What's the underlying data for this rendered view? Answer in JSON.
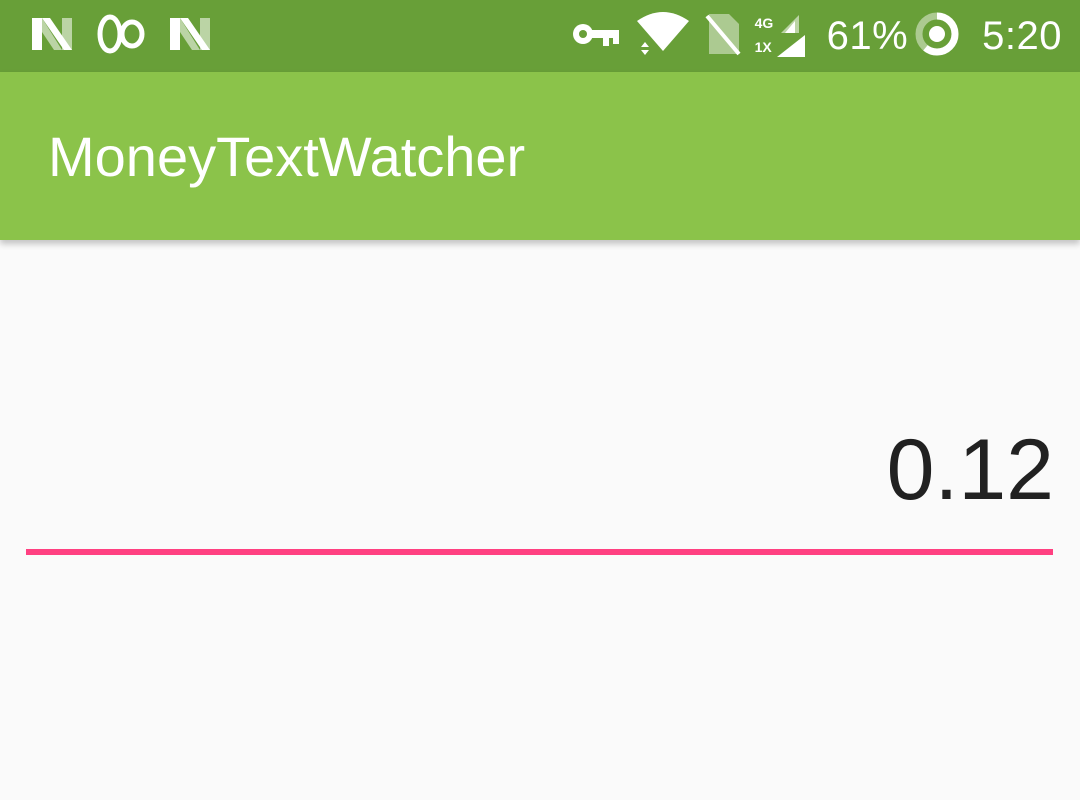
{
  "status_bar": {
    "left_icons": [
      "n-notification-icon",
      "infinity-icon",
      "n-notification-icon"
    ],
    "right_icons": [
      "vpn-key-icon",
      "wifi-icon",
      "no-sim-icon",
      "signal-icon"
    ],
    "network_type": "4G",
    "sim_slot": "1X",
    "battery_percent": "61%",
    "battery_level": 0.61,
    "time": "5:20"
  },
  "app_bar": {
    "title": "MoneyTextWatcher"
  },
  "main": {
    "money_input_value": "0.12",
    "accent_color": "#ff4081"
  },
  "colors": {
    "status_bar": "#689f38",
    "app_bar": "#8bc34a",
    "background": "#fafafa"
  }
}
